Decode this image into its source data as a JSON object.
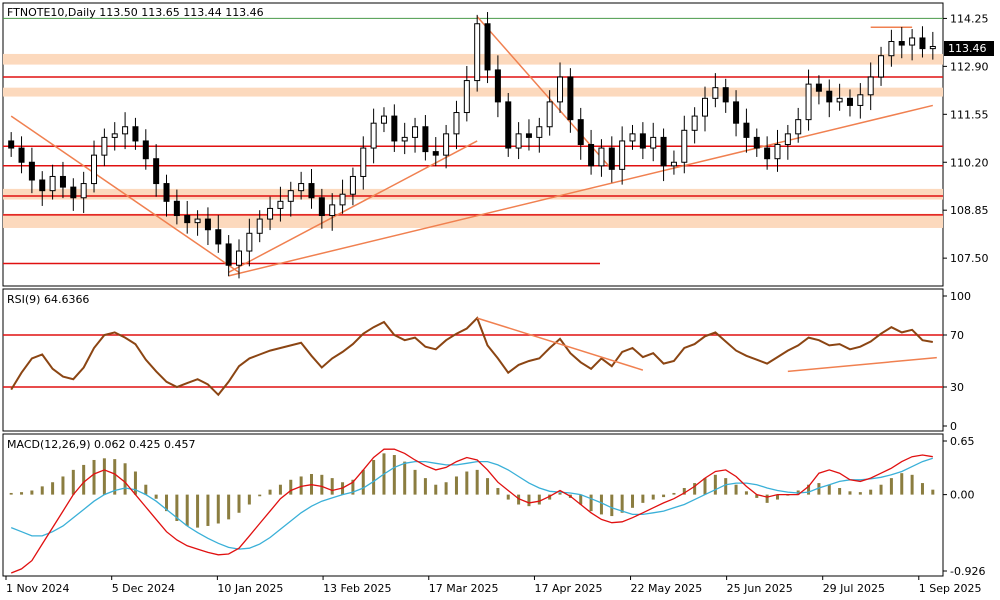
{
  "chart_data": [
    {
      "type": "candlestick",
      "header": "FTNOTE10,Daily  113.50 113.65 113.44 113.46",
      "current_price": "113.46",
      "ylim": [
        106.8,
        114.6
      ],
      "y_ticks": [
        "114.25",
        "112.90",
        "111.55",
        "110.20",
        "108.85",
        "107.50"
      ],
      "x_ticks": [
        "1 Nov 2024",
        "5 Dec 2024",
        "10 Jan 2025",
        "13 Feb 2025",
        "17 Mar 2025",
        "17 Apr 2025",
        "22 May 2025",
        "25 Jun 2025",
        "29 Jul 2025",
        "1 Sep 2025"
      ],
      "close_series": [
        110.6,
        110.2,
        109.7,
        109.4,
        109.8,
        109.5,
        109.2,
        109.6,
        110.4,
        110.9,
        111.0,
        111.2,
        110.8,
        110.3,
        109.6,
        109.1,
        108.7,
        108.5,
        108.6,
        108.3,
        107.9,
        107.3,
        107.7,
        108.2,
        108.6,
        108.9,
        109.1,
        109.4,
        109.6,
        109.2,
        108.7,
        109.0,
        109.3,
        109.8,
        110.6,
        111.3,
        111.5,
        110.8,
        110.9,
        111.2,
        110.5,
        110.4,
        111.0,
        111.6,
        112.5,
        114.1,
        112.8,
        111.9,
        110.6,
        111.0,
        110.9,
        111.2,
        111.9,
        112.6,
        111.4,
        110.7,
        110.1,
        110.6,
        110.0,
        110.8,
        111.0,
        110.6,
        110.9,
        110.1,
        110.2,
        111.1,
        111.5,
        112.0,
        112.3,
        111.9,
        111.3,
        110.9,
        110.6,
        110.3,
        110.7,
        111.0,
        111.4,
        112.4,
        112.2,
        111.9,
        112.0,
        111.8,
        112.1,
        112.6,
        113.2,
        113.6,
        113.5,
        113.7,
        113.4,
        113.46
      ],
      "horizontal_levels": [
        114.25,
        112.6,
        110.65,
        110.1,
        109.25,
        108.72,
        107.35
      ],
      "zones": [
        [
          112.95,
          113.25
        ],
        [
          112.05,
          112.3
        ],
        [
          109.15,
          109.45
        ],
        [
          108.35,
          108.75
        ]
      ],
      "colors": {
        "bull": "#000000",
        "bear": "#000000",
        "level": "#e01010",
        "zone": "#fcd9bd",
        "trend": "#f08050",
        "top": "#4a9a4a"
      }
    },
    {
      "type": "line",
      "title": "RSI(9) 64.6366",
      "ylim": [
        0,
        100
      ],
      "y_ticks": [
        "100",
        "70",
        "30",
        "0"
      ],
      "levels": [
        70,
        30
      ],
      "series": [
        {
          "values": [
            28,
            41,
            52,
            55,
            44,
            38,
            36,
            45,
            60,
            70,
            72,
            68,
            63,
            51,
            42,
            34,
            30,
            33,
            36,
            32,
            24,
            34,
            46,
            52,
            55,
            58,
            60,
            62,
            64,
            54,
            45,
            52,
            57,
            63,
            71,
            76,
            80,
            70,
            66,
            68,
            61,
            59,
            66,
            71,
            75,
            83,
            62,
            52,
            41,
            47,
            50,
            52,
            60,
            67,
            56,
            49,
            44,
            52,
            46,
            57,
            60,
            53,
            56,
            48,
            50,
            60,
            63,
            69,
            72,
            65,
            58,
            54,
            51,
            48,
            53,
            58,
            62,
            68,
            66,
            62,
            63,
            59,
            61,
            65,
            71,
            76,
            72,
            74,
            66,
            64.6
          ]
        }
      ],
      "colors": {
        "line": "#8b4513",
        "level": "#e01010",
        "trend": "#f08050"
      }
    },
    {
      "type": "macd",
      "title": "MACD(12,26,9) 0.062 0.425 0.457",
      "ylim": [
        -0.926,
        0.65
      ],
      "y_ticks": [
        "0.65",
        "0.00",
        "-0.926"
      ],
      "histogram": [
        0.02,
        0.03,
        0.05,
        0.1,
        0.15,
        0.22,
        0.3,
        0.36,
        0.42,
        0.44,
        0.43,
        0.38,
        0.28,
        0.12,
        -0.05,
        -0.2,
        -0.32,
        -0.38,
        -0.4,
        -0.38,
        -0.35,
        -0.3,
        -0.22,
        -0.12,
        -0.02,
        0.06,
        0.12,
        0.18,
        0.22,
        0.25,
        0.24,
        0.2,
        0.15,
        0.18,
        0.3,
        0.42,
        0.5,
        0.48,
        0.4,
        0.3,
        0.2,
        0.12,
        0.15,
        0.22,
        0.28,
        0.3,
        0.2,
        0.08,
        -0.06,
        -0.12,
        -0.14,
        -0.12,
        -0.06,
        0.02,
        -0.04,
        -0.12,
        -0.2,
        -0.24,
        -0.26,
        -0.22,
        -0.16,
        -0.1,
        -0.06,
        -0.03,
        0.02,
        0.08,
        0.14,
        0.2,
        0.24,
        0.2,
        0.12,
        0.04,
        -0.04,
        -0.1,
        -0.06,
        0.0,
        0.05,
        0.12,
        0.14,
        0.12,
        0.08,
        0.04,
        0.03,
        0.06,
        0.12,
        0.2,
        0.26,
        0.24,
        0.14,
        0.06
      ],
      "macd": [
        -0.95,
        -0.9,
        -0.8,
        -0.6,
        -0.4,
        -0.2,
        0.0,
        0.15,
        0.25,
        0.3,
        0.25,
        0.15,
        0.0,
        -0.15,
        -0.3,
        -0.45,
        -0.55,
        -0.62,
        -0.66,
        -0.7,
        -0.73,
        -0.72,
        -0.65,
        -0.5,
        -0.35,
        -0.2,
        -0.05,
        0.05,
        0.1,
        0.12,
        0.1,
        0.05,
        0.08,
        0.15,
        0.3,
        0.45,
        0.55,
        0.55,
        0.5,
        0.42,
        0.35,
        0.3,
        0.33,
        0.4,
        0.45,
        0.42,
        0.3,
        0.15,
        0.05,
        -0.05,
        -0.1,
        -0.08,
        -0.02,
        0.05,
        -0.02,
        -0.12,
        -0.22,
        -0.3,
        -0.34,
        -0.33,
        -0.28,
        -0.22,
        -0.16,
        -0.1,
        -0.05,
        0.02,
        0.1,
        0.2,
        0.28,
        0.3,
        0.22,
        0.1,
        0.0,
        -0.03,
        0.0,
        0.0,
        0.0,
        0.1,
        0.26,
        0.3,
        0.26,
        0.18,
        0.16,
        0.2,
        0.26,
        0.32,
        0.4,
        0.46,
        0.48,
        0.46
      ],
      "signal": [
        -0.4,
        -0.45,
        -0.5,
        -0.5,
        -0.45,
        -0.38,
        -0.28,
        -0.18,
        -0.08,
        0.0,
        0.05,
        0.08,
        0.06,
        0.0,
        -0.08,
        -0.18,
        -0.28,
        -0.38,
        -0.46,
        -0.53,
        -0.59,
        -0.64,
        -0.66,
        -0.65,
        -0.6,
        -0.52,
        -0.42,
        -0.32,
        -0.22,
        -0.14,
        -0.08,
        -0.04,
        0.0,
        0.03,
        0.08,
        0.16,
        0.25,
        0.33,
        0.38,
        0.4,
        0.4,
        0.38,
        0.36,
        0.36,
        0.38,
        0.4,
        0.4,
        0.36,
        0.3,
        0.22,
        0.14,
        0.08,
        0.04,
        0.03,
        0.02,
        0.0,
        -0.05,
        -0.1,
        -0.16,
        -0.2,
        -0.24,
        -0.24,
        -0.22,
        -0.2,
        -0.16,
        -0.12,
        -0.06,
        0.0,
        0.06,
        0.12,
        0.14,
        0.14,
        0.12,
        0.08,
        0.05,
        0.03,
        0.02,
        0.03,
        0.08,
        0.12,
        0.16,
        0.18,
        0.18,
        0.19,
        0.21,
        0.24,
        0.28,
        0.34,
        0.4,
        0.44
      ],
      "colors": {
        "hist": "#8b7d40",
        "macd": "#e01010",
        "signal": "#3ab0d8",
        "zero": "#000000"
      }
    }
  ]
}
